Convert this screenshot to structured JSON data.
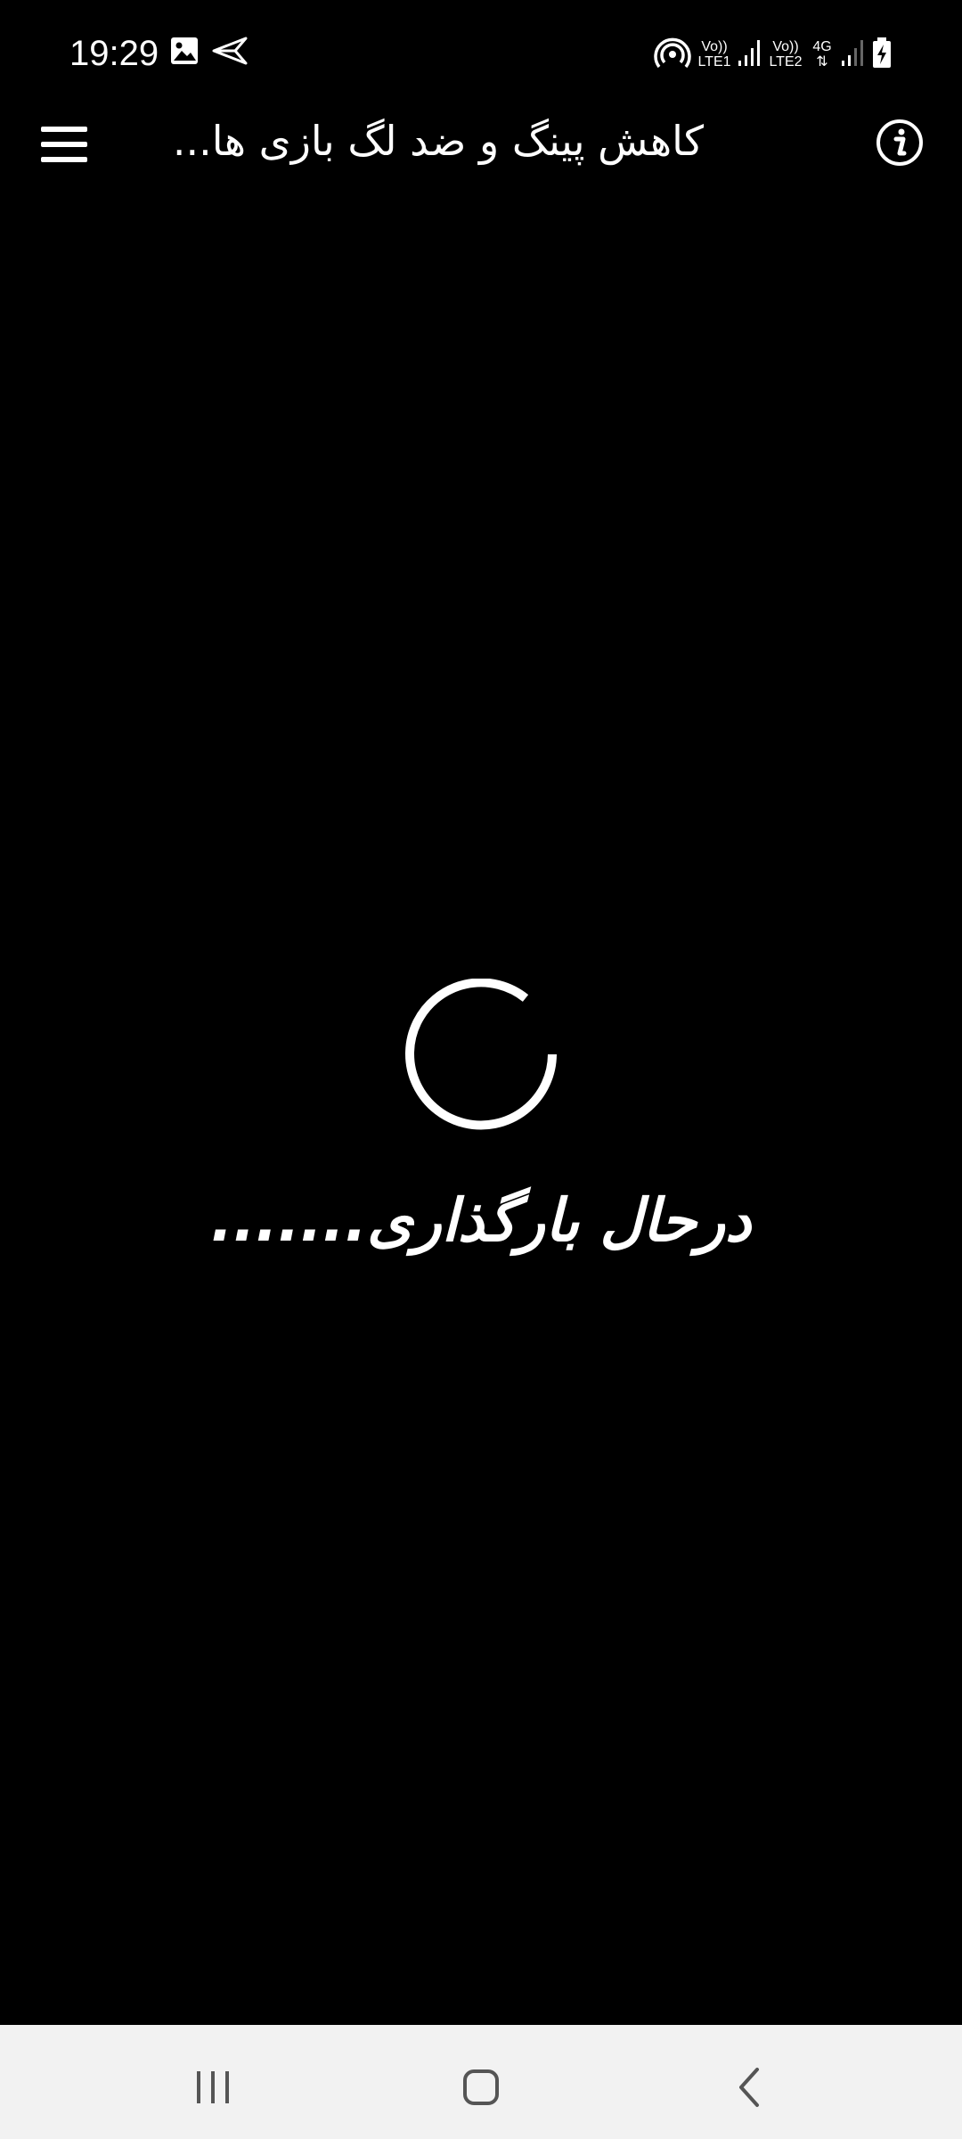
{
  "status_bar": {
    "time": "19:29",
    "left_icons": [
      "image-icon",
      "send-icon"
    ],
    "right_icons": [
      "hotspot-icon",
      "volte-lte1",
      "signal-icon",
      "volte-lte2",
      "4g-arrows",
      "signal-icon",
      "battery-charging-icon"
    ],
    "lte1_label_top": "Vo))",
    "lte1_label_bottom": "LTE1",
    "lte2_label_top": "Vo))",
    "lte2_label_bottom": "LTE2",
    "net_type": "4G"
  },
  "app_bar": {
    "title": "کاهش پینگ و ضد لگ بازی ها...",
    "menu_icon": "hamburger-menu-icon",
    "info_icon": "info-icon"
  },
  "loading": {
    "text": "درحال بارگذاری......."
  },
  "nav_bar": {
    "buttons": [
      "recents",
      "home",
      "back"
    ]
  }
}
